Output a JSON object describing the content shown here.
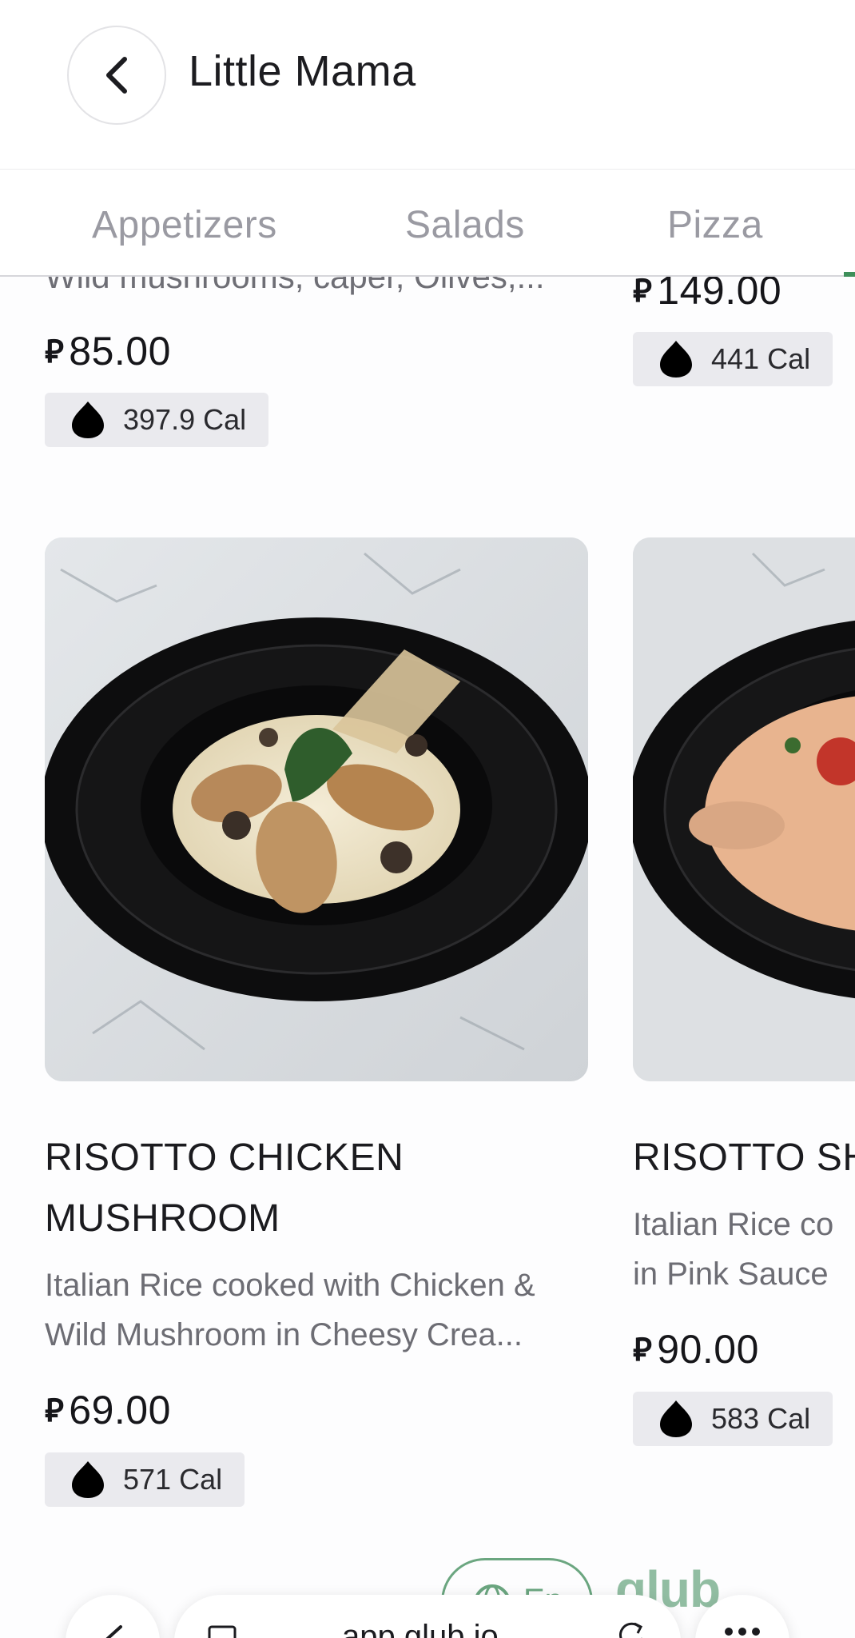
{
  "header": {
    "title": "Little Mama",
    "back_icon": "chevron-left-icon"
  },
  "tabs": [
    {
      "label": "Appetizers"
    },
    {
      "label": "Salads"
    },
    {
      "label": "Pizza"
    }
  ],
  "prev_row": {
    "left": {
      "desc_clipped": "Wild mushrooms, caper, Olives,...",
      "currency": "⃁",
      "price": "85.00",
      "calories": "397.9 Cal"
    },
    "right": {
      "currency": "⃁",
      "price": "149.00",
      "calories": "441 Cal"
    }
  },
  "items": [
    {
      "name_line1": "RISOTTO CHICKEN",
      "name_line2": "MUSHROOM",
      "desc_line1": "Italian Rice cooked with Chicken &",
      "desc_line2": "Wild Mushroom in Cheesy Crea...",
      "currency": "⃁",
      "price": "69.00",
      "calories": "571 Cal"
    },
    {
      "name_line1": "RISOTTO SH",
      "desc_line1": "Italian Rice co",
      "desc_line2": "in Pink Sauce",
      "currency": "⃁",
      "price": "90.00",
      "calories": "583 Cal"
    }
  ],
  "footer": {
    "lang_label": "En",
    "brand": "glub",
    "url": "app.glub.io"
  },
  "colors": {
    "accent": "#3e8f5a",
    "badge_bg": "#eaeaee",
    "tab_inactive": "#9a9aa2"
  }
}
